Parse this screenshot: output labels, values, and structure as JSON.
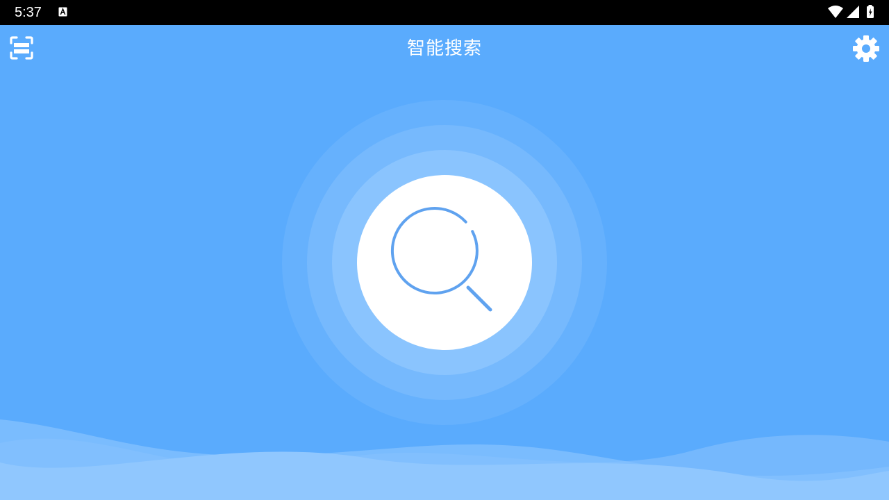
{
  "status_bar": {
    "time": "5:37",
    "notification_icon": "text-a-icon",
    "icons": [
      "wifi-icon",
      "signal-icon",
      "battery-charging-icon"
    ]
  },
  "header": {
    "title": "智能搜索",
    "left_icon": "scan-icon",
    "right_icon": "gear-icon"
  },
  "main": {
    "center_icon": "search-icon"
  },
  "colors": {
    "background": "#5aabfd",
    "ring_outer": "#66b1fd",
    "ring_middle": "#76b9fd",
    "ring_inner": "#8ac4fe",
    "circle": "#ffffff",
    "magnifier": "#5fa2ef"
  }
}
